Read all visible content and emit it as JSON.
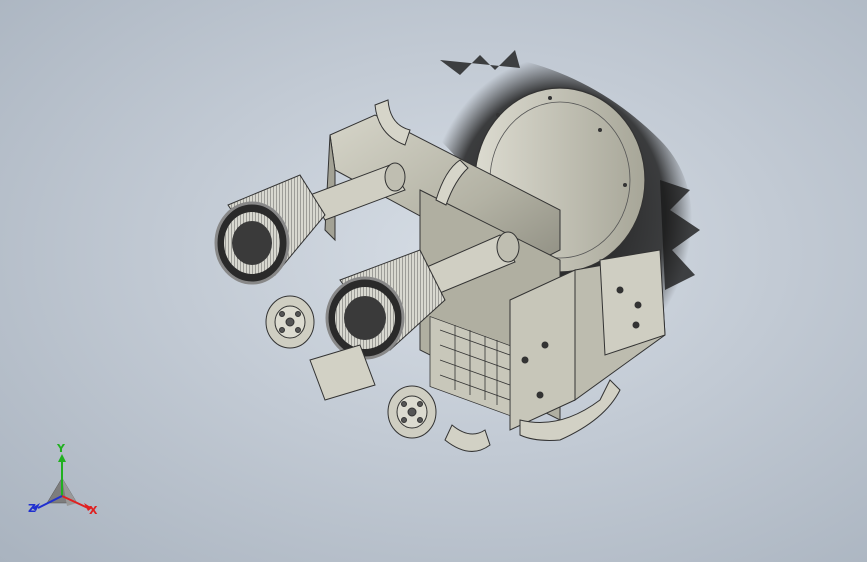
{
  "viewport": {
    "background_top": "#d6dde5",
    "background_bottom": "#a9b3bf",
    "model_color": "#b5b4a6"
  },
  "triad": {
    "x_label": "X",
    "y_label": "Y",
    "z_label": "Z",
    "x_color": "#e02020",
    "y_color": "#20b020",
    "z_color": "#2030d0"
  }
}
